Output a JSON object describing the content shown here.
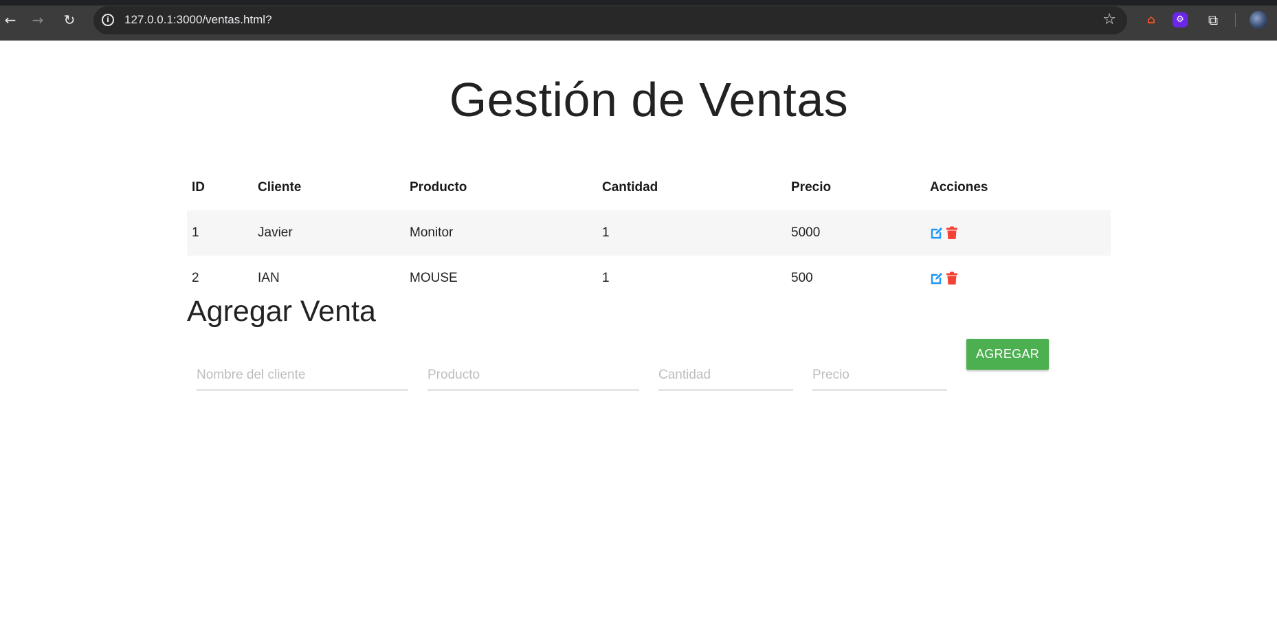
{
  "browser": {
    "url": "127.0.0.1:3000/ventas.html?",
    "back_icon": "arrow-left-icon",
    "forward_icon": "arrow-right-icon",
    "reload_icon": "reload-icon"
  },
  "page": {
    "title": "Gestión de Ventas",
    "table": {
      "headers": [
        "ID",
        "Cliente",
        "Producto",
        "Cantidad",
        "Precio",
        "Acciones"
      ],
      "rows": [
        {
          "id": "1",
          "cliente": "Javier",
          "producto": "Monitor",
          "cantidad": "1",
          "precio": "5000"
        },
        {
          "id": "2",
          "cliente": "IAN",
          "producto": "MOUSE",
          "cantidad": "1",
          "precio": "500"
        }
      ],
      "edit_icon": "edit-icon",
      "delete_icon": "trash-icon",
      "edit_color": "#2196f3",
      "delete_color": "#f44336"
    },
    "form": {
      "title": "Agregar Venta",
      "cliente_placeholder": "Nombre del cliente",
      "producto_placeholder": "Producto",
      "cantidad_placeholder": "Cantidad",
      "precio_placeholder": "Precio",
      "submit_label": "AGREGAR",
      "submit_color": "#4caf50"
    }
  }
}
